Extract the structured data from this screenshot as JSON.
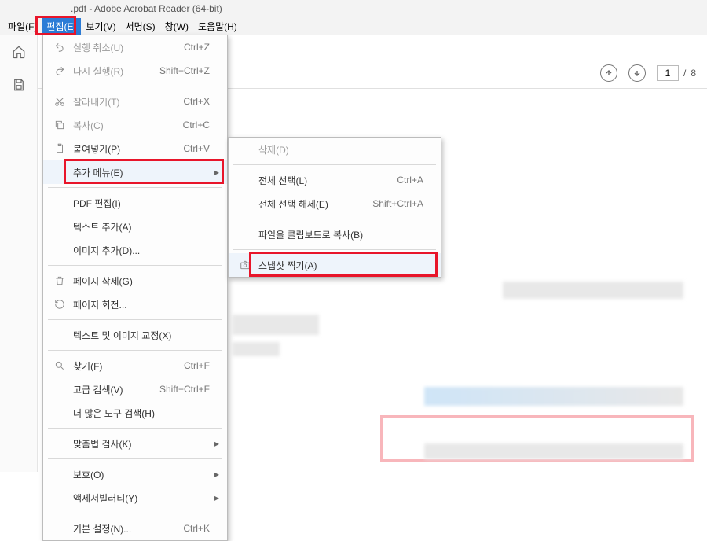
{
  "title": ".pdf - Adobe Acrobat Reader (64-bit)",
  "menubar": [
    "파일(F)",
    "편집(E)",
    "보기(V)",
    "서명(S)",
    "창(W)",
    "도움말(H)"
  ],
  "active_menu_index": 1,
  "page": {
    "current": "1",
    "sep": "/",
    "total": "8"
  },
  "m1": [
    {
      "icon": "undo",
      "label": "실행 취소(U)",
      "accel": "Ctrl+Z",
      "disabled": true
    },
    {
      "icon": "redo",
      "label": "다시 실행(R)",
      "accel": "Shift+Ctrl+Z",
      "disabled": true
    },
    {
      "sep": true
    },
    {
      "icon": "cut",
      "label": "잘라내기(T)",
      "accel": "Ctrl+X",
      "disabled": true
    },
    {
      "icon": "copy",
      "label": "복사(C)",
      "accel": "Ctrl+C",
      "disabled": true
    },
    {
      "icon": "paste",
      "label": "붙여넣기(P)",
      "accel": "Ctrl+V"
    },
    {
      "icon": "",
      "label": "추가 메뉴(E)",
      "accel": "",
      "sub": true,
      "hover": true,
      "hl": true
    },
    {
      "sep": true
    },
    {
      "icon": "",
      "label": "PDF 편집(I)"
    },
    {
      "icon": "",
      "label": "텍스트 추가(A)"
    },
    {
      "icon": "",
      "label": "이미지 추가(D)..."
    },
    {
      "sep": true
    },
    {
      "icon": "trash",
      "label": "페이지 삭제(G)"
    },
    {
      "icon": "rotate",
      "label": "페이지 회전..."
    },
    {
      "sep": true
    },
    {
      "icon": "",
      "label": "텍스트 및 이미지 교정(X)"
    },
    {
      "sep": true
    },
    {
      "icon": "search",
      "label": "찾기(F)",
      "accel": "Ctrl+F"
    },
    {
      "icon": "",
      "label": "고급 검색(V)",
      "accel": "Shift+Ctrl+F"
    },
    {
      "icon": "",
      "label": "더 많은 도구 검색(H)"
    },
    {
      "sep": true
    },
    {
      "icon": "",
      "label": "맞춤법 검사(K)",
      "sub": true
    },
    {
      "sep": true
    },
    {
      "icon": "",
      "label": "보호(O)",
      "sub": true
    },
    {
      "icon": "",
      "label": "액세서빌러티(Y)",
      "sub": true
    },
    {
      "sep": true
    },
    {
      "icon": "",
      "label": "기본 설정(N)...",
      "accel": "Ctrl+K"
    }
  ],
  "m2": [
    {
      "label": "삭제(D)",
      "disabled": true
    },
    {
      "sep": true
    },
    {
      "label": "전체 선택(L)",
      "accel": "Ctrl+A"
    },
    {
      "label": "전체 선택 해제(E)",
      "accel": "Shift+Ctrl+A"
    },
    {
      "sep": true
    },
    {
      "label": "파일을 클립보드로 복사(B)"
    },
    {
      "sep": true
    },
    {
      "icon": "camera",
      "label": "스냅샷 찍기(A)",
      "hover": true,
      "hl": true
    }
  ]
}
